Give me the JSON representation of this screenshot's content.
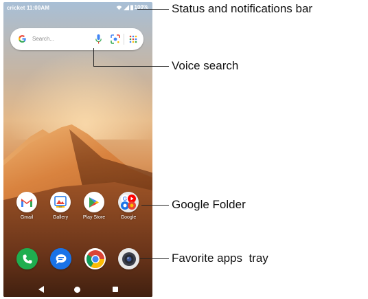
{
  "status_bar": {
    "carrier_time": "cricket 11:00AM",
    "battery": "100%"
  },
  "search": {
    "placeholder": "Search..."
  },
  "home_apps": [
    {
      "label": "Gmail",
      "icon": "gmail-icon"
    },
    {
      "label": "Gallery",
      "icon": "gallery-icon"
    },
    {
      "label": "Play Store",
      "icon": "play-store-icon"
    },
    {
      "label": "Google",
      "icon": "google-folder-icon"
    }
  ],
  "dock": [
    {
      "icon": "phone-icon",
      "color": "#1fae4f"
    },
    {
      "icon": "messages-icon",
      "color": "#1a73e8"
    },
    {
      "icon": "chrome-icon",
      "color": "#ffffff"
    },
    {
      "icon": "camera-icon",
      "color": "#e8e8e8"
    }
  ],
  "nav": {
    "back": "back-icon",
    "home": "home-icon",
    "recents": "recents-icon"
  },
  "callouts": {
    "status": "Status and notifications bar",
    "voice": "Voice search",
    "folder": "Google Folder",
    "tray": "Favorite apps  tray"
  }
}
